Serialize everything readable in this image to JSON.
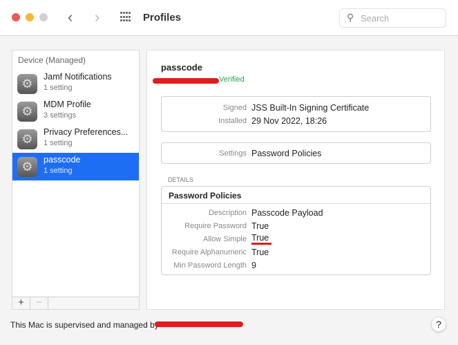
{
  "window": {
    "title": "Profiles",
    "search_placeholder": "Search"
  },
  "sidebar": {
    "header": "Device (Managed)",
    "items": [
      {
        "name": "Jamf Notifications",
        "sub": "1 setting"
      },
      {
        "name": "MDM Profile",
        "sub": "3 settings"
      },
      {
        "name": "Privacy Preferences...",
        "sub": "1 setting"
      },
      {
        "name": "passcode",
        "sub": "1 setting"
      }
    ],
    "add": "+",
    "remove": "−"
  },
  "profile": {
    "name": "passcode",
    "status": "Verified",
    "signed_label": "Signed",
    "signed": "JSS Built-In Signing Certificate",
    "installed_label": "Installed",
    "installed": "29 Nov 2022, 18:26",
    "settings_label": "Settings",
    "settings": "Password Policies",
    "details_label": "DETAILS",
    "policy": {
      "title": "Password Policies",
      "rows": [
        {
          "k": "Description",
          "v": "Passcode Payload"
        },
        {
          "k": "Require Password",
          "v": "True"
        },
        {
          "k": "Allow Simple",
          "v": "True"
        },
        {
          "k": "Require Alphanumeric",
          "v": "True"
        },
        {
          "k": "Min Password Length",
          "v": "9"
        }
      ]
    }
  },
  "footer": {
    "text": "This Mac is supervised and managed by",
    "help": "?"
  }
}
